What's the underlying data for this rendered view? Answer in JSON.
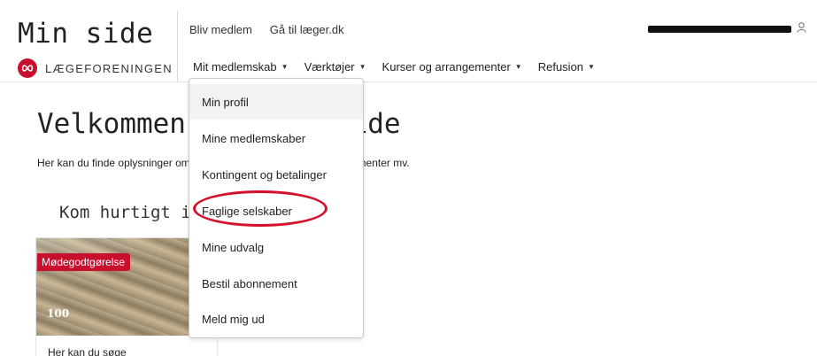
{
  "header": {
    "site_title": "Min side",
    "brand_name": "LÆGEFORENINGEN",
    "top_links": [
      "Bliv medlem",
      "Gå til læger.dk"
    ],
    "main_nav": [
      "Mit medlemskab",
      "Værktøjer",
      "Kurser og arrangementer",
      "Refusion"
    ]
  },
  "dropdown": {
    "items": [
      "Min profil",
      "Mine medlemskaber",
      "Kontingent og betalinger",
      "Faglige selskaber",
      "Mine udvalg",
      "Bestil abonnement",
      "Meld mig ud"
    ],
    "active_index": 0,
    "highlighted_index": 3
  },
  "page": {
    "title": "Velkommen til Min side",
    "intro": "Her kan du finde oplysninger om dit medlemskab, kurser og arrangementer mv.",
    "quick_title": "Kom hurtigt i gang"
  },
  "card": {
    "tag": "Mødegodtgørelse",
    "image_text": "100",
    "text": "Her kan du søge"
  },
  "colors": {
    "brand_red": "#c8102e",
    "highlight_ring": "#d3112a"
  }
}
